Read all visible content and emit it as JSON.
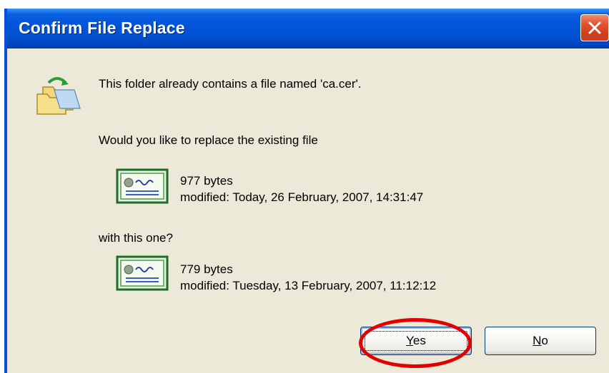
{
  "dialog": {
    "title": "Confirm File Replace",
    "message_exists_prefix": "This folder already contains a file named '",
    "file_name": "ca.cer",
    "message_exists_suffix": "'.",
    "question": "Would you like to replace the existing file",
    "existing_file": {
      "size": "977 bytes",
      "modified": "modified: Today, 26 February, 2007, 14:31:47"
    },
    "with_text": "with this one?",
    "new_file": {
      "size": "779 bytes",
      "modified": "modified: Tuesday, 13 February, 2007, 11:12:12"
    },
    "buttons": {
      "yes_accel": "Y",
      "yes_rest": "es",
      "no_accel": "N",
      "no_rest": "o"
    }
  },
  "icons": {
    "close": "close-icon",
    "folder": "folder-copy-icon",
    "certificate": "certificate-icon"
  },
  "colors": {
    "titlebar": "#0254D9",
    "dialog_bg": "#ECE9D8",
    "close_button": "#D0401C",
    "annotation": "#E30000"
  }
}
